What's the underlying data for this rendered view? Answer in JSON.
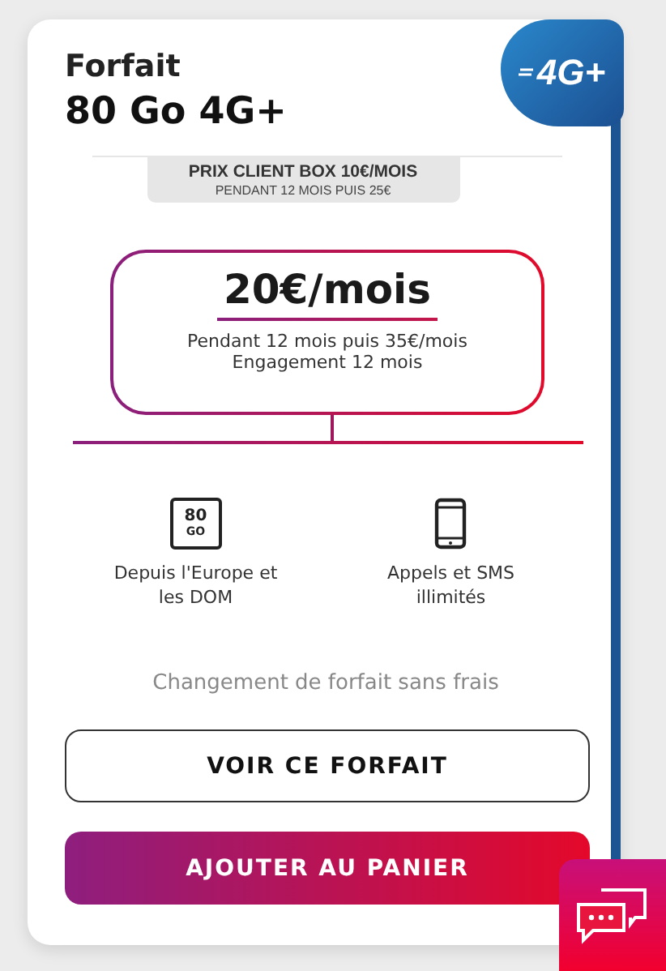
{
  "plan": {
    "label": "Forfait",
    "name": "80 Go 4G+",
    "badge": "4G+"
  },
  "promo": {
    "title": "PRIX CLIENT BOX 10€/MOIS",
    "subtitle": "PENDANT 12 MOIS PUIS 25€"
  },
  "price": {
    "amount": "20€/mois",
    "details": [
      "Pendant 12 mois puis 35€/mois",
      "Engagement 12 mois"
    ]
  },
  "features": [
    {
      "kind": "data",
      "icon_text": [
        "80",
        "GO"
      ],
      "label": "Depuis l'Europe et les DOM"
    },
    {
      "kind": "phone",
      "label": "Appels et SMS illimités"
    }
  ],
  "note": "Changement de forfait sans frais",
  "buttons": [
    {
      "kind": "outline",
      "label": "VOIR CE FORFAIT"
    },
    {
      "kind": "gradient",
      "label": "AJOUTER AU PANIER"
    }
  ]
}
